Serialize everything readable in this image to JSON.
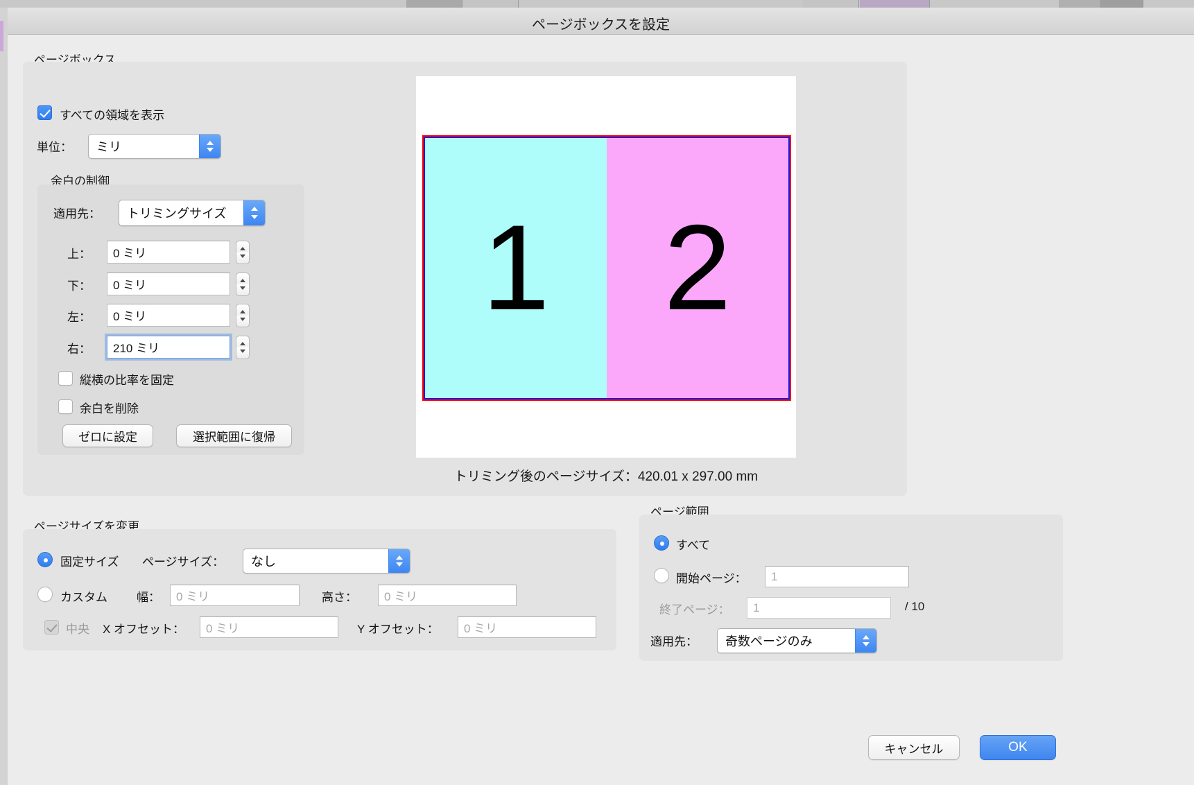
{
  "window": {
    "title": "ページボックスを設定"
  },
  "page_box": {
    "group_label": "ページボックス",
    "show_all_regions": {
      "label": "すべての領域を表示",
      "checked": true
    },
    "unit": {
      "label": "単位：",
      "value": "ミリ"
    },
    "margin_control": {
      "group_label": "余白の制御",
      "apply_to": {
        "label": "適用先：",
        "value": "トリミングサイズ"
      },
      "fields": [
        {
          "label": "上：",
          "value": "0 ミリ",
          "focused": false
        },
        {
          "label": "下：",
          "value": "0 ミリ",
          "focused": false
        },
        {
          "label": "左：",
          "value": "0 ミリ",
          "focused": false
        },
        {
          "label": "右：",
          "value": "210 ミリ",
          "focused": true
        }
      ],
      "lock_ratio": {
        "label": "縦横の比率を固定",
        "checked": false
      },
      "remove_margins": {
        "label": "余白を削除",
        "checked": false
      },
      "set_zero_button": "ゼロに設定",
      "revert_selection_button": "選択範囲に復帰"
    },
    "preview": {
      "left_page_number": "1",
      "right_page_number": "2",
      "left_page_color": "#affdfb",
      "right_page_color": "#fba8fb",
      "outer_border_color": "#ff0000",
      "inner_border_color": "#1a1ae6",
      "caption": "トリミング後のページサイズ：420.01 x 297.00 mm"
    }
  },
  "change_page_size": {
    "group_label": "ページサイズを変更",
    "fixed_size": {
      "label": "固定サイズ",
      "selected": true
    },
    "page_size": {
      "label": "ページサイズ：",
      "value": "なし"
    },
    "custom": {
      "label": "カスタム",
      "selected": false
    },
    "width": {
      "label": "幅：",
      "placeholder": "0 ミリ",
      "value": ""
    },
    "height": {
      "label": "高さ：",
      "placeholder": "0 ミリ",
      "value": ""
    },
    "center": {
      "label": "中央",
      "checked": true,
      "disabled": true
    },
    "x_offset": {
      "label": "X オフセット：",
      "placeholder": "0 ミリ",
      "value": ""
    },
    "y_offset": {
      "label": "Y オフセット：",
      "placeholder": "0 ミリ",
      "value": ""
    }
  },
  "page_range": {
    "group_label": "ページ範囲",
    "all": {
      "label": "すべて",
      "selected": true
    },
    "start_page": {
      "label": "開始ページ：",
      "placeholder": "1",
      "value": "",
      "selected": false
    },
    "end_page": {
      "label": "終了ページ：",
      "placeholder": "1",
      "value": "",
      "total": "/ 10"
    },
    "apply_to": {
      "label": "適用先：",
      "value": "奇数ページのみ"
    }
  },
  "footer": {
    "cancel_button": "キャンセル",
    "ok_button": "OK"
  }
}
